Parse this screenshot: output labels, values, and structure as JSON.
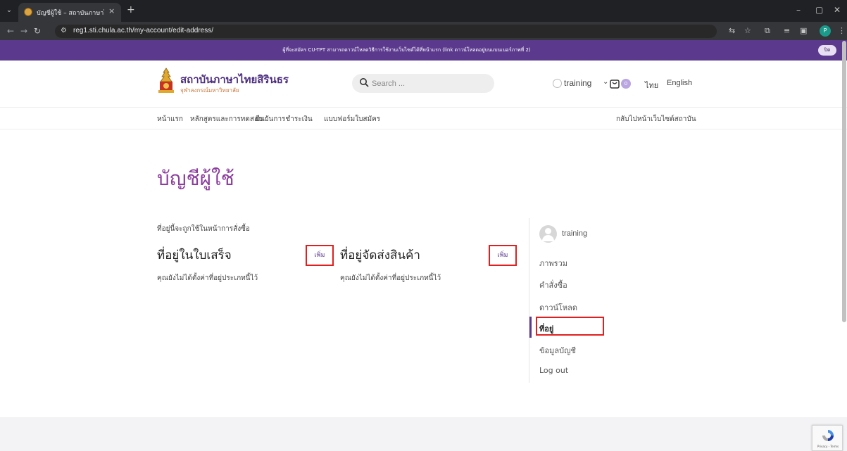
{
  "browser": {
    "tab_title": "บัญชีผู้ใช้ – สถาบันภาษาไทยสิรินธร",
    "tab_close": "×",
    "new_tab": "+",
    "url": "reg1.sti.chula.ac.th/my-account/edit-address/",
    "window_controls": [
      "–",
      "▢",
      "✕"
    ]
  },
  "announcement": {
    "text": "ผู้ที่จะสมัคร CU-TPT สามารถดาวน์โหลดวิธีการใช้งานเว็บไซต์ได้ที่หน้าแรก (link ดาวน์โหลดอยู่บนแบนเนอร์ภาพที่ 2)",
    "close_label": "ปิด"
  },
  "header": {
    "logo_title": "สถาบันภาษาไทยสิรินธร",
    "logo_subtitle": "จุฬาลงกรณ์มหาวิทยาลัย",
    "search_placeholder": "Search ...",
    "username": "training",
    "cart_count": "0",
    "lang_th": "ไทย",
    "lang_en": "English"
  },
  "nav": {
    "items": [
      "หน้าแรก",
      "หลักสูตรและการทดสอบ",
      "ยืนยันการชำระเงิน",
      "แบบฟอร์มใบสมัคร"
    ],
    "back_link": "กลับไปหน้าเว็บไซต์สถาบัน"
  },
  "page": {
    "title": "บัญชีผู้ใช้",
    "intro": "ที่อยู่นี้จะถูกใช้ในหน้าการสั่งซื้อ",
    "billing": {
      "title": "ที่อยู่ในใบเสร็จ",
      "add_label": "เพิ่ม",
      "empty": "คุณยังไม่ได้ตั้งค่าที่อยู่ประเภทนี้ไว้"
    },
    "shipping": {
      "title": "ที่อยู่จัดส่งสินค้า",
      "add_label": "เพิ่ม",
      "empty": "คุณยังไม่ได้ตั้งค่าที่อยู่ประเภทนี้ไว้"
    }
  },
  "account_nav": {
    "username": "training",
    "items": [
      "ภาพรวม",
      "คำสั่งซื้อ",
      "ดาวน์โหลด",
      "ที่อยู่",
      "ข้อมูลบัญชี",
      "Log out"
    ],
    "active": "ที่อยู่"
  },
  "recaptcha": {
    "footer": "Privacy - Terms"
  },
  "colors": {
    "brand_purple": "#5b3a8e",
    "title_purple": "#8c3d9e",
    "highlight_red": "#e02020"
  }
}
